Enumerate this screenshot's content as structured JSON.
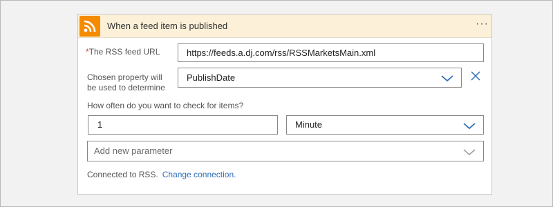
{
  "header": {
    "title": "When a feed item is published",
    "more_icon": "more-dots-icon",
    "more_glyph": "···",
    "icon": "rss-icon",
    "accent_color": "#f58b00"
  },
  "fields": {
    "feed_url": {
      "required_mark": "*",
      "label": "The RSS feed URL",
      "value": "https://feeds.a.dj.com/rss/RSSMarketsMain.xml"
    },
    "chosen_property": {
      "label_line1": "Chosen property will",
      "label_line2": "be used to determine",
      "value": "PublishDate"
    },
    "frequency": {
      "label": "How often do you want to check for items?",
      "interval_value": "1",
      "unit_value": "Minute"
    },
    "add_parameter": {
      "placeholder": "Add new parameter"
    }
  },
  "footer": {
    "connected_text": "Connected to RSS.",
    "change_link": "Change connection."
  }
}
